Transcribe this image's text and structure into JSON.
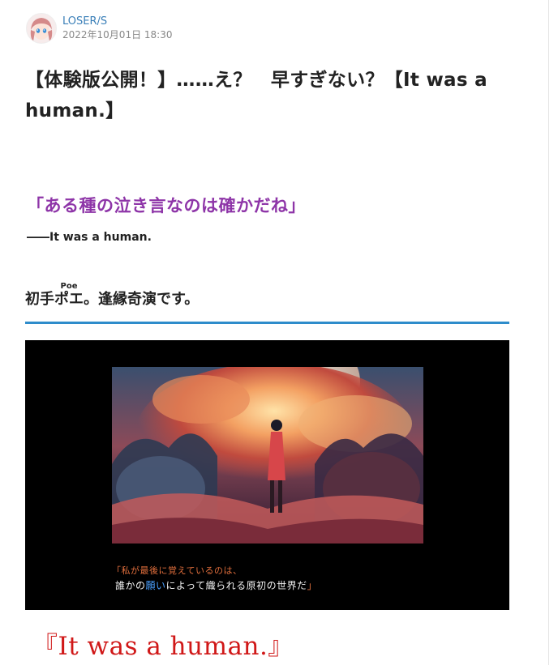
{
  "author": {
    "name": "LOSER/S",
    "date": "2022年10月01日 18:30"
  },
  "post": {
    "title": "【体験版公開！】……え？　早すぎない？【It was a human.】",
    "quote": "「ある種の泣き言なのは確かだね」",
    "attribution": "――It was a human.",
    "heading": {
      "part1": "初手",
      "ruby_base": "ポエ",
      "ruby_text": "Poe",
      "part2": "。逢縁奇演です。"
    }
  },
  "game_screen": {
    "caption_line1": "「私が最後に覚えているのは、",
    "caption_line2_a": "誰かの",
    "caption_line2_highlight": "願い",
    "caption_line2_b": "によって織られる原初の世界だ",
    "caption_line2_close": "」"
  },
  "game_title": "『It was a human.』",
  "colors": {
    "link": "#3a7fb8",
    "quote": "#8e35a8",
    "heading_rule": "#2e8ccb",
    "game_title": "#d01818"
  }
}
